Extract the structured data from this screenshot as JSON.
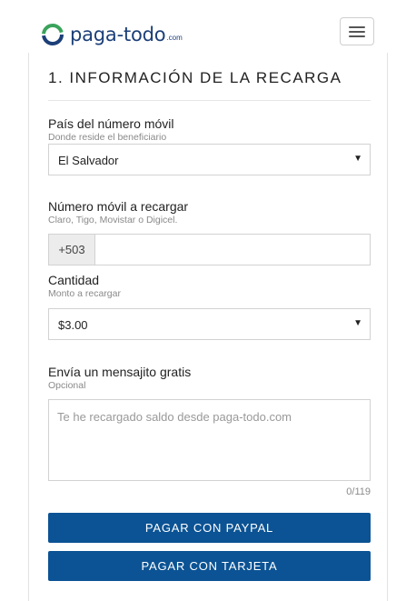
{
  "header": {
    "logo_text": "paga-todo",
    "logo_suffix": ".com",
    "menu_icon": "hamburger-menu-icon"
  },
  "section": {
    "title": "1. INFORMACIÓN DE LA RECARGA"
  },
  "country": {
    "label": "País del número móvil",
    "hint": "Donde reside el beneficiario",
    "selected": "El Salvador"
  },
  "phone": {
    "label": "Número móvil a recargar",
    "hint": "Claro, Tigo, Movistar o Digicel.",
    "prefix": "+503",
    "value": ""
  },
  "amount": {
    "label": "Cantidad",
    "hint": "Monto a recargar",
    "selected": "$3.00"
  },
  "message": {
    "label": "Envía un mensajito gratis",
    "hint": "Opcional",
    "placeholder": "Te he recargado saldo desde paga-todo.com",
    "counter": "0/119"
  },
  "buttons": {
    "paypal": "PAGAR CON PAYPAL",
    "card": "PAGAR CON TARJETA"
  },
  "colors": {
    "primary": "#0b5394",
    "logo_blue": "#1c3f78",
    "logo_green": "#3aa35b"
  }
}
